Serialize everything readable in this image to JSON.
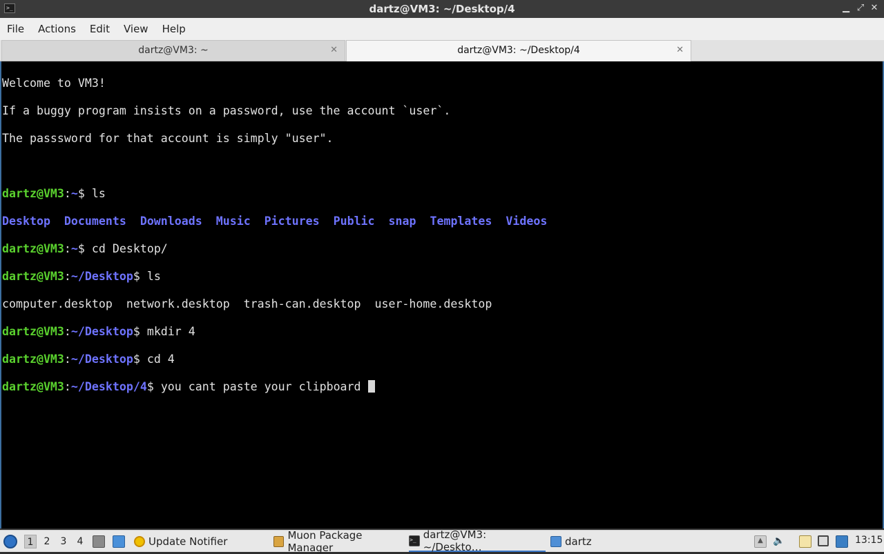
{
  "window": {
    "title": "dartz@VM3: ~/Desktop/4",
    "controls": [
      "minimize-icon",
      "maximize-icon",
      "close-icon"
    ]
  },
  "menu": [
    "File",
    "Actions",
    "Edit",
    "View",
    "Help"
  ],
  "tabs": [
    {
      "label": "dartz@VM3: ~",
      "active": false,
      "close": "✕"
    },
    {
      "label": "dartz@VM3: ~/Desktop/4",
      "active": true,
      "close": "✕"
    }
  ],
  "terminal": {
    "welcome": [
      "Welcome to VM3!",
      "If a buggy program insists on a password, use the account `user`.",
      "The passsword for that account is simply \"user\"."
    ],
    "lines": [
      {
        "user": "dartz@VM3",
        "path": "~",
        "cmd": "ls"
      },
      {
        "dirs": [
          "Desktop",
          "Documents",
          "Downloads",
          "Music",
          "Pictures",
          "Public",
          "snap",
          "Templates",
          "Videos"
        ]
      },
      {
        "user": "dartz@VM3",
        "path": "~",
        "cmd": "cd Desktop/"
      },
      {
        "user": "dartz@VM3",
        "path": "~/Desktop",
        "cmd": "ls"
      },
      {
        "files": "computer.desktop  network.desktop  trash-can.desktop  user-home.desktop"
      },
      {
        "user": "dartz@VM3",
        "path": "~/Desktop",
        "cmd": "mkdir 4"
      },
      {
        "user": "dartz@VM3",
        "path": "~/Desktop",
        "cmd": "cd 4"
      },
      {
        "user": "dartz@VM3",
        "path": "~/Desktop/4",
        "cmd": "you cant paste your clipboard "
      }
    ]
  },
  "taskbar": {
    "workspaces": [
      "1",
      "2",
      "3",
      "4"
    ],
    "active_workspace": "1",
    "tasks": [
      {
        "label": "Update Notifier",
        "icon": "update-notifier-icon"
      },
      {
        "label": "Muon Package Manager",
        "icon": "package-manager-icon"
      },
      {
        "label": "dartz@VM3: ~/Deskto…",
        "icon": "terminal-icon",
        "active": true
      },
      {
        "label": "dartz",
        "icon": "folder-icon"
      }
    ],
    "tray": [
      "up-arrow-icon",
      "volume-icon",
      "clipboard-icon",
      "network-icon",
      "notification-icon"
    ],
    "clock": "13:15"
  },
  "colors": {
    "prompt_user": "#5ad12e",
    "prompt_path": "#6e73ff",
    "terminal_bg": "#000000",
    "terminal_fg": "#e2e2e2"
  }
}
